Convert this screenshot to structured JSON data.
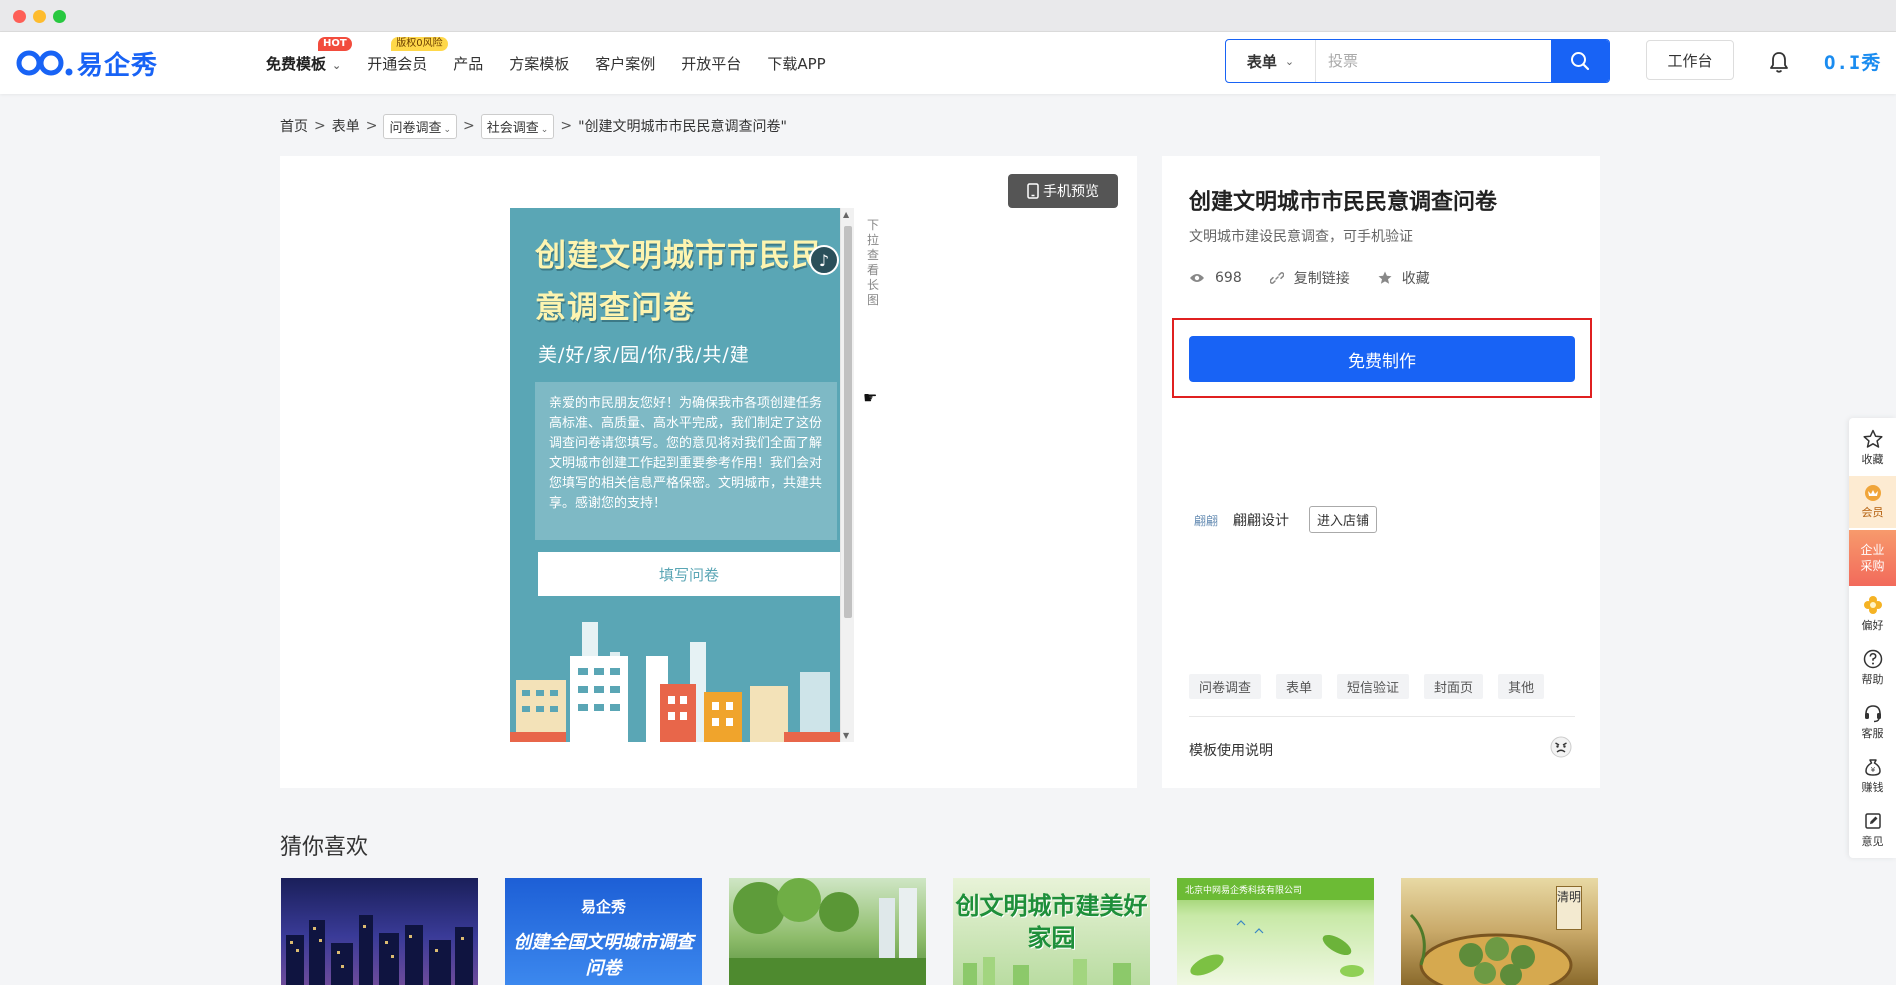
{
  "nav": {
    "logo_text": "易企秀",
    "items": [
      {
        "label": "免费模板",
        "badge": "HOT"
      },
      {
        "label": "开通会员",
        "badge": "版权0风险"
      },
      {
        "label": "产品"
      },
      {
        "label": "方案模板"
      },
      {
        "label": "客户案例"
      },
      {
        "label": "开放平台"
      },
      {
        "label": "下载APP"
      }
    ],
    "search_type": "表单",
    "search_placeholder": "投票",
    "workbench": "工作台",
    "brand_mini": "O.I秀"
  },
  "breadcrumb": {
    "home": "首页",
    "form": "表单",
    "category": "问卷调查",
    "subcategory": "社会调查",
    "current": "\"创建文明城市市民民意调查问卷\""
  },
  "preview": {
    "mobile_preview": "手机预览",
    "long_hint": "下拉查看长图",
    "phone_title": "创建文明城市市民民意调查问卷",
    "phone_subtitle": "美/好/家/园/你/我/共/建",
    "phone_body": "亲爱的市民朋友您好！为确保我市各项创建任务高标准、高质量、高水平完成，我们制定了这份调查问卷请您填写。您的意见将对我们全面了解文明城市创建工作起到重要参考作用！我们会对您填写的相关信息严格保密。文明城市，共建共享。感谢您的支持！",
    "phone_button": "填写问卷",
    "scroll_position": 0.03
  },
  "info": {
    "title": "创建文明城市市民民意调查问卷",
    "description": "文明城市建设民意调查，可手机验证",
    "views": "698",
    "copy_link": "复制链接",
    "favorite": "收藏",
    "free_make": "免费制作",
    "designer_logo_text": "翩翩",
    "designer": "翩翩设计",
    "enter_shop": "进入店铺",
    "tags": [
      "问卷调查",
      "表单",
      "短信验证",
      "封面页",
      "其他"
    ],
    "usage": "模板使用说明"
  },
  "guess": {
    "title": "猜你喜欢",
    "cards": [
      {
        "text": ""
      },
      {
        "logo": "易企秀",
        "text": "创建全国文明城市调查问卷"
      },
      {
        "text": ""
      },
      {
        "text": "创文明城市建美好家园"
      },
      {
        "bar": "北京中网易企秀科技有限公司"
      },
      {
        "tag": "清明"
      }
    ]
  },
  "sidebar": [
    {
      "label": "收藏"
    },
    {
      "label": "会员"
    },
    {
      "label": "企业采购"
    },
    {
      "label": "偏好"
    },
    {
      "label": "帮助"
    },
    {
      "label": "客服"
    },
    {
      "label": "赚钱"
    },
    {
      "label": "意见"
    }
  ],
  "colors": {
    "primary": "#1863f5",
    "highlight": "#e02020",
    "phone_bg": "#5aa6b5"
  }
}
